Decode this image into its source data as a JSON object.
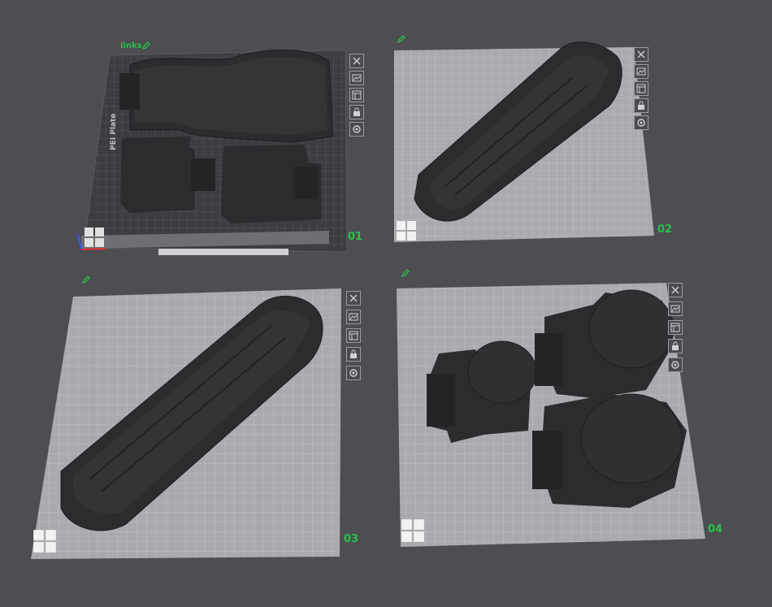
{
  "colors": {
    "background": "#4d4d52",
    "plate_light": "#a8a8ad",
    "plate_dark": "#3a3a3f",
    "model": "#2c2c2e",
    "accent_green": "#2bc04a"
  },
  "plates": [
    {
      "name": "links",
      "number": "01",
      "selected": true,
      "print_logo": "PEI Plate",
      "icons": [
        "close-icon",
        "arrange-icon",
        "layout-icon",
        "lock-icon",
        "settings-icon"
      ]
    },
    {
      "name": "",
      "number": "02",
      "selected": false,
      "icons": [
        "close-icon",
        "arrange-icon",
        "layout-icon",
        "lock-icon",
        "settings-icon"
      ]
    },
    {
      "name": "",
      "number": "03",
      "selected": false,
      "icons": [
        "close-icon",
        "arrange-icon",
        "layout-icon",
        "lock-icon",
        "settings-icon"
      ]
    },
    {
      "name": "",
      "number": "04",
      "selected": false,
      "icons": [
        "close-icon",
        "arrange-icon",
        "layout-icon",
        "lock-icon",
        "settings-icon"
      ]
    }
  ]
}
